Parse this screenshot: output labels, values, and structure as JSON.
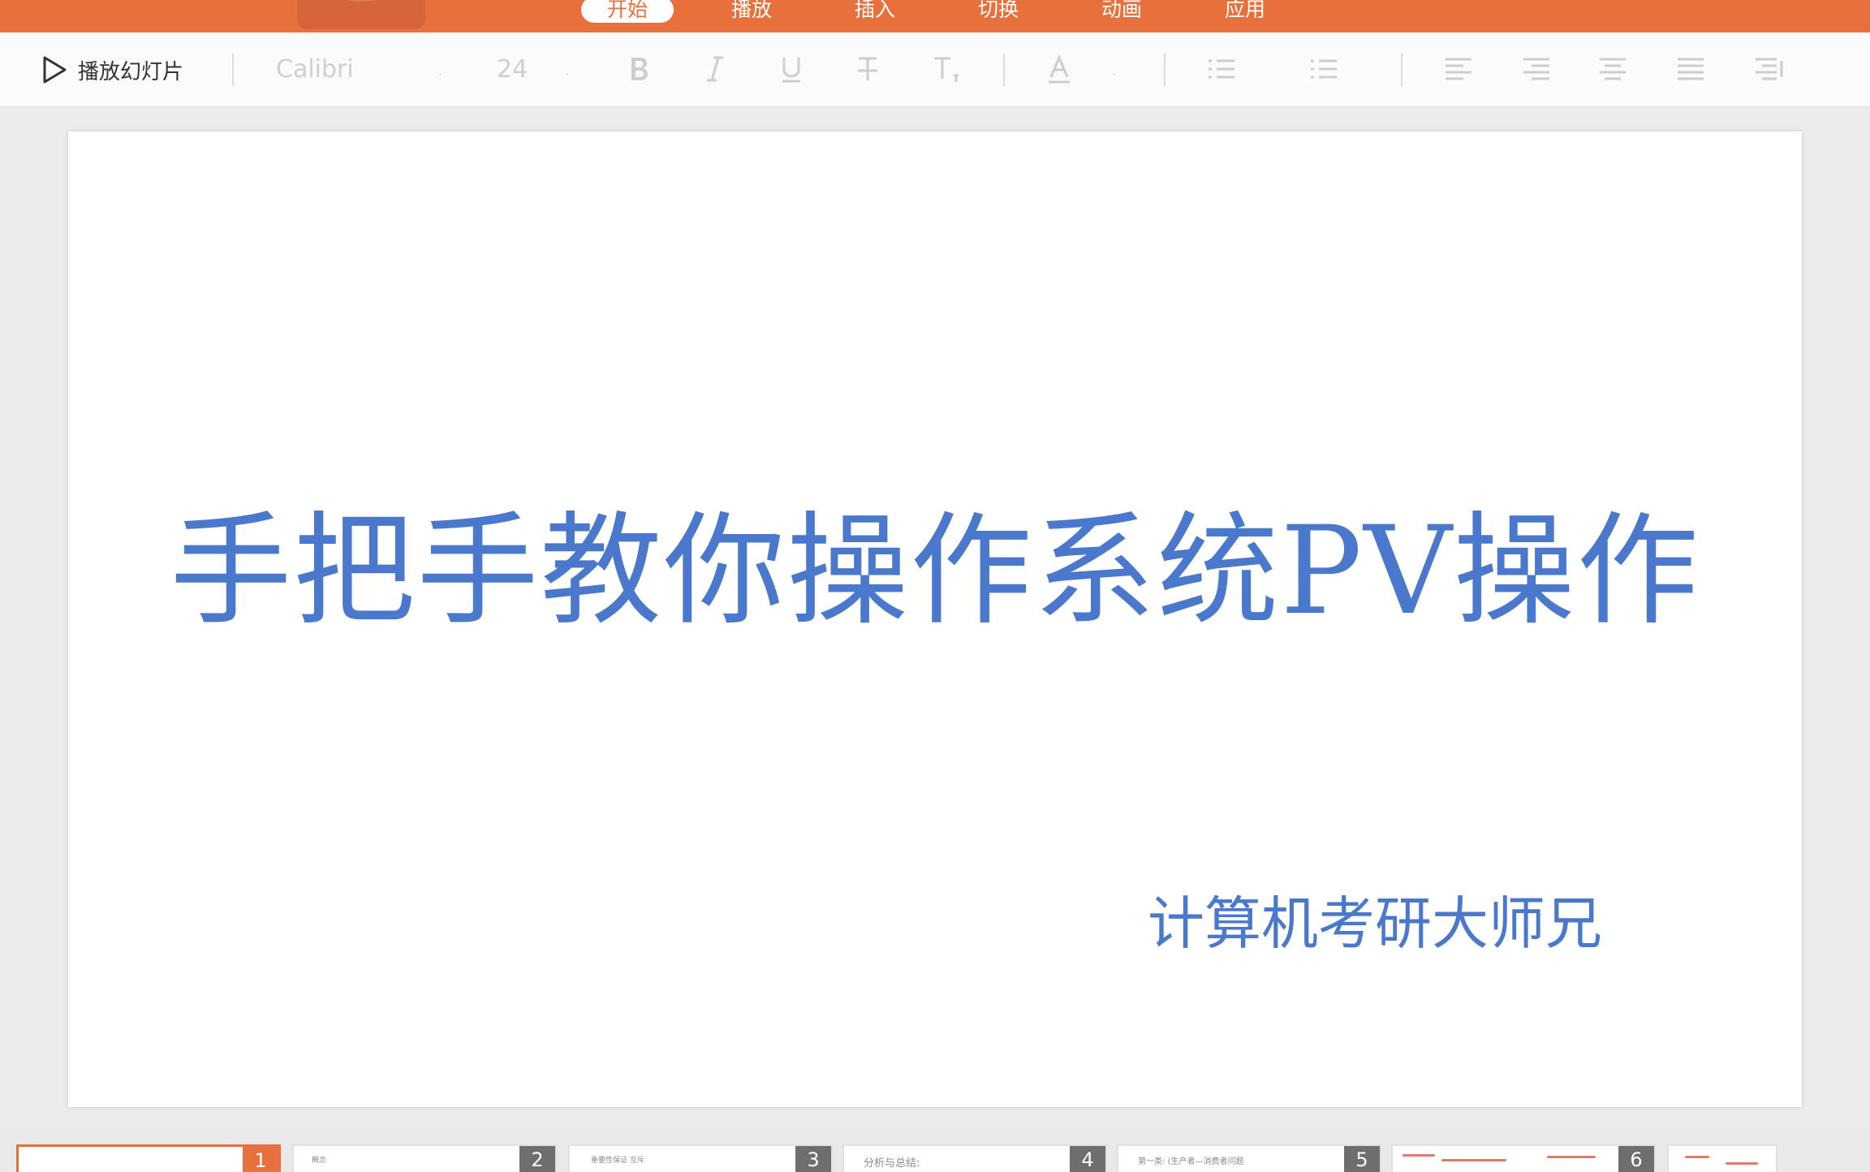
{
  "tabs": {
    "start": "开始",
    "play": "播放",
    "insert": "插入",
    "transition": "切换",
    "animation": "动画",
    "apply": "应用"
  },
  "toolbar": {
    "play_slideshow": "播放幻灯片",
    "font_name": "Calibri",
    "font_size": "24",
    "caret": "·"
  },
  "slide": {
    "title": "手把手教你操作系统PV操作",
    "subtitle": "计算机考研大师兄"
  },
  "thumbnails": {
    "items": [
      {
        "number": "1",
        "text": ""
      },
      {
        "number": "2",
        "text": "概念"
      },
      {
        "number": "3",
        "text": "重要性保证 互斥"
      },
      {
        "number": "4",
        "text": "分析与总结:"
      },
      {
        "number": "5",
        "text": "第一类: (生产者—消费者问题"
      },
      {
        "number": "6",
        "text": ""
      }
    ]
  },
  "colors": {
    "accent": "#e8703c",
    "title_blue": "#4a78cc"
  }
}
